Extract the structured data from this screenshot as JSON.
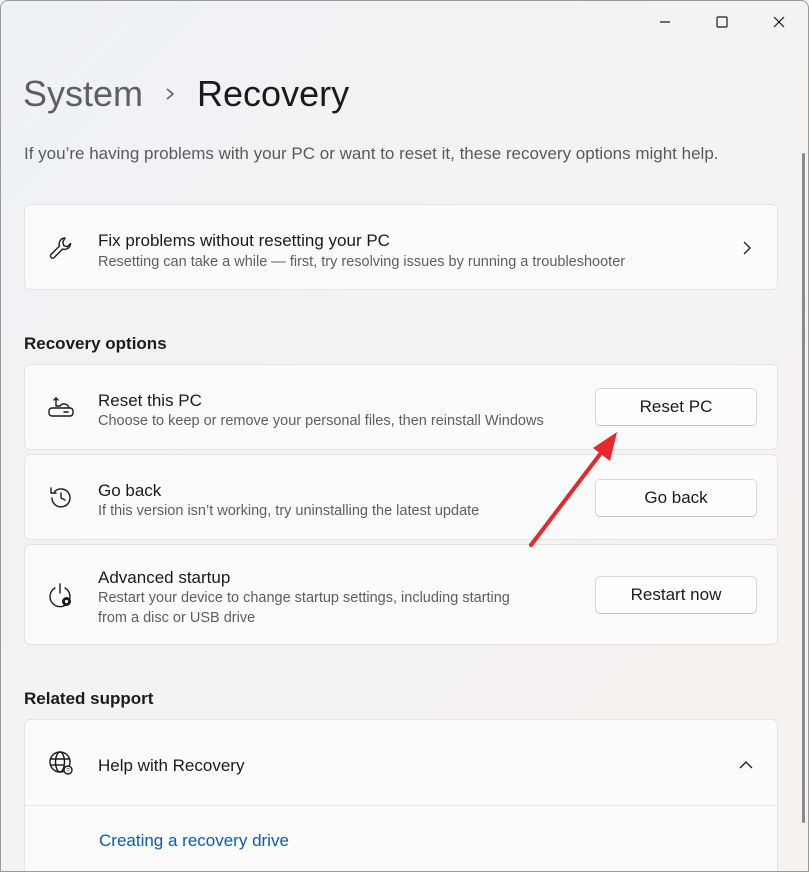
{
  "titlebar": {
    "minimize_icon": "minimize-icon",
    "maximize_icon": "maximize-icon",
    "close_icon": "close-icon"
  },
  "breadcrumb": {
    "parent": "System",
    "separator_icon": "chevron-right-icon",
    "current": "Recovery"
  },
  "intro": "If you’re having problems with your PC or want to reset it, these recovery options might help.",
  "fix_card": {
    "icon": "wrench-icon",
    "title": "Fix problems without resetting your PC",
    "subtitle": "Resetting can take a while — first, try resolving issues by running a troubleshooter",
    "chevron_icon": "chevron-right-icon"
  },
  "recovery_options": {
    "heading": "Recovery options",
    "items": [
      {
        "icon": "reset-pc-icon",
        "title": "Reset this PC",
        "subtitle": "Choose to keep or remove your personal files, then reinstall Windows",
        "button": "Reset PC"
      },
      {
        "icon": "history-icon",
        "title": "Go back",
        "subtitle": "If this version isn’t working, try uninstalling the latest update",
        "button": "Go back"
      },
      {
        "icon": "power-settings-icon",
        "title": "Advanced startup",
        "subtitle_line1": "Restart your device to change startup settings, including starting",
        "subtitle_line2": "from a disc or USB drive",
        "button": "Restart now"
      }
    ]
  },
  "related_support": {
    "heading": "Related support",
    "help_card": {
      "icon": "globe-icon",
      "title": "Help with Recovery",
      "chevron_icon": "chevron-up-icon",
      "links": [
        "Creating a recovery drive"
      ]
    }
  },
  "annotation": {
    "arrow_color": "#e8262b",
    "points_to": "Reset PC"
  },
  "colors": {
    "link": "#0b5bb5",
    "card_bg": "#fbfbfb",
    "text_primary": "#1b1b1b",
    "text_secondary": "#5e5e5e"
  }
}
